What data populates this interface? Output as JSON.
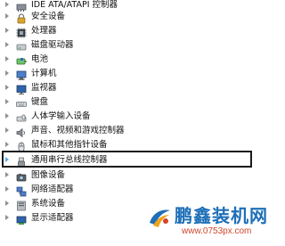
{
  "device_tree": {
    "items": [
      {
        "label": "IDE ATA/ATAPI 控制器",
        "icon": "ide-controller-icon"
      },
      {
        "label": "安全设备",
        "icon": "security-device-icon"
      },
      {
        "label": "处理器",
        "icon": "processor-icon"
      },
      {
        "label": "磁盘驱动器",
        "icon": "disk-drive-icon"
      },
      {
        "label": "电池",
        "icon": "battery-icon"
      },
      {
        "label": "计算机",
        "icon": "computer-icon"
      },
      {
        "label": "监视器",
        "icon": "monitor-icon"
      },
      {
        "label": "键盘",
        "icon": "keyboard-icon"
      },
      {
        "label": "人体学输入设备",
        "icon": "hid-icon"
      },
      {
        "label": "声音、视频和游戏控制器",
        "icon": "sound-icon"
      },
      {
        "label": "鼠标和其他指针设备",
        "icon": "mouse-icon"
      },
      {
        "label": "通用串行总线控制器",
        "icon": "usb-icon",
        "selected": true
      },
      {
        "label": "图像设备",
        "icon": "camera-icon"
      },
      {
        "label": "网络适配器",
        "icon": "network-adapter-icon"
      },
      {
        "label": "系统设备",
        "icon": "system-device-icon"
      },
      {
        "label": "显示适配器",
        "icon": "display-adapter-icon"
      }
    ]
  },
  "watermark": {
    "title": "鹏鑫装机网",
    "url": "www.0753px.com"
  },
  "colors": {
    "text": "#111111",
    "expander": "#8f8f8f",
    "expander_highlight": "#5fa8e6",
    "selection_border": "#1a1a1a",
    "watermark_title": "#1d6fb8",
    "watermark_url": "#d0462b"
  }
}
